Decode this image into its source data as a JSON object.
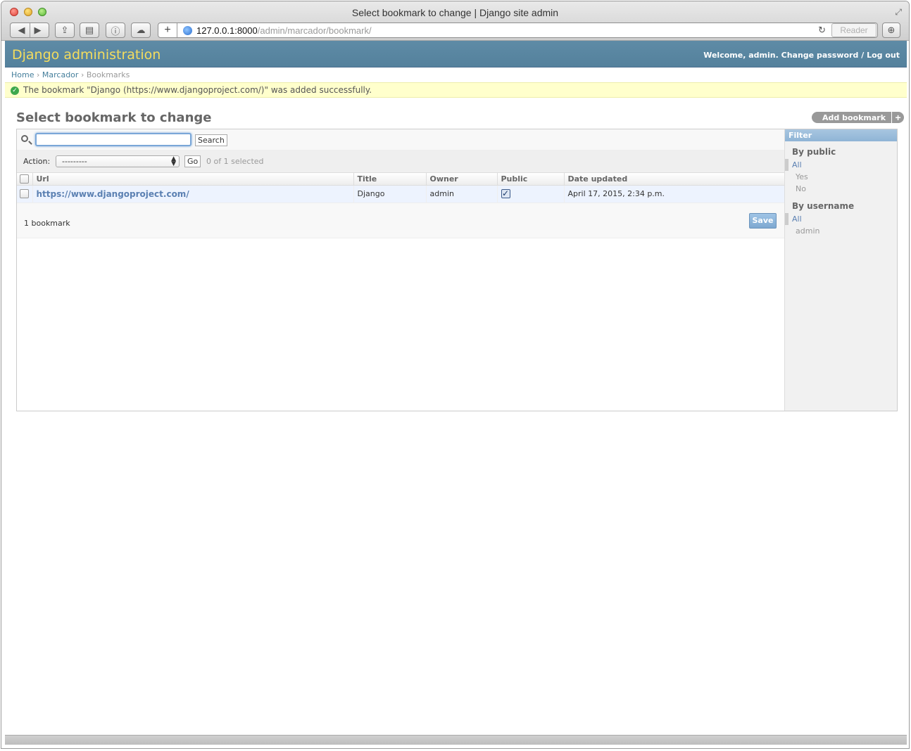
{
  "browser": {
    "window_title": "Select bookmark to change | Django site admin",
    "url_host": "127.0.0.1:8000",
    "url_path": "/admin/marcador/bookmark/",
    "reader_label": "Reader"
  },
  "header": {
    "branding": "Django administration",
    "welcome": "Welcome,",
    "username": "admin",
    "change_password": "Change password",
    "separator": "/",
    "logout": "Log out"
  },
  "breadcrumbs": {
    "home": "Home",
    "app": "Marcador",
    "current": "Bookmarks",
    "sep": "›"
  },
  "message": "The bookmark \"Django (https://www.djangoproject.com/)\" was added successfully.",
  "content": {
    "title": "Select bookmark to change",
    "add_button": "Add bookmark"
  },
  "search": {
    "value": "",
    "button_label": "Search"
  },
  "actions": {
    "label": "Action:",
    "selected_option": "---------",
    "go_label": "Go",
    "counter": "0 of 1 selected"
  },
  "table": {
    "columns": [
      "Url",
      "Title",
      "Owner",
      "Public",
      "Date updated"
    ],
    "rows": [
      {
        "url": "https://www.djangoproject.com/",
        "title": "Django",
        "owner": "admin",
        "public": true,
        "date_updated": "April 17, 2015, 2:34 p.m."
      }
    ]
  },
  "paginator": {
    "count": "1 bookmark",
    "save_label": "Save"
  },
  "filter": {
    "title": "Filter",
    "groups": [
      {
        "heading": "By public",
        "options": [
          "All",
          "Yes",
          "No"
        ],
        "selected": "All"
      },
      {
        "heading": "By username",
        "options": [
          "All",
          "admin"
        ],
        "selected": "All"
      }
    ]
  },
  "colors": {
    "header_bg": "#5e8ba6",
    "branding": "#f5dd5d",
    "link": "#5b80b2",
    "message_bg": "#ffffcc"
  }
}
